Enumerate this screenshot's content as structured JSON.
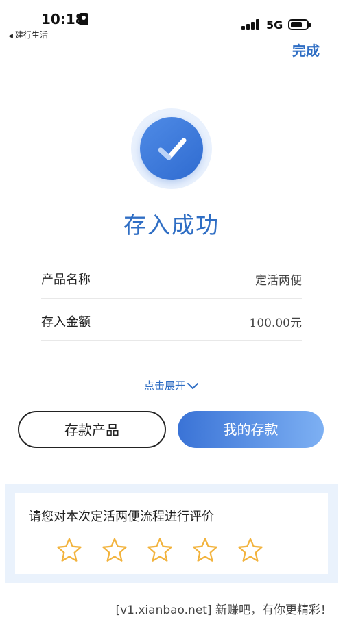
{
  "status_bar": {
    "time": "10:18",
    "back_app": "建行生活",
    "network": "5G"
  },
  "header": {
    "done_label": "完成"
  },
  "result": {
    "title": "存入成功"
  },
  "details": [
    {
      "label": "产品名称",
      "value": "定活两便"
    },
    {
      "label": "存入金额",
      "value": "100.00元"
    }
  ],
  "expand_label": "点击展开",
  "buttons": {
    "deposit_products": "存款产品",
    "my_deposits": "我的存款"
  },
  "rating": {
    "title": "请您对本次定活两便流程进行评价",
    "stars_total": 5,
    "stars_selected": 0
  },
  "watermark": "[v1.xianbao.net] 新赚吧，有你更精彩！",
  "colors": {
    "accent": "#2f6ec4",
    "star": "#f2b33d",
    "panel_bg": "#eaf2fc"
  }
}
